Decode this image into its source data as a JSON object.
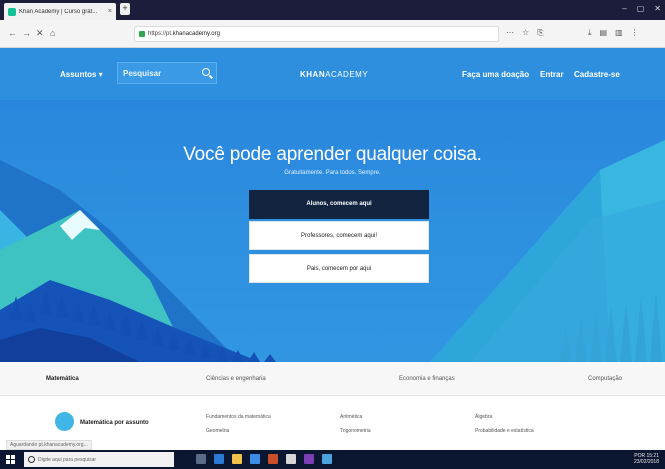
{
  "browser": {
    "tab_title": "Khan Academy | Curso grát...",
    "tab_close": "×",
    "new_tab": "+",
    "window_buttons": [
      "–",
      "▢",
      "✕"
    ],
    "nav_icons": [
      "←",
      "→",
      "✕",
      "⌂"
    ],
    "url_prefix": "https://pt.",
    "url_domain": "khanacademy.org",
    "url_actions": [
      "⋯",
      "☆",
      "⎘"
    ],
    "toolbar_icons": [
      "⤓",
      "▤",
      "▥",
      "⋮"
    ]
  },
  "header": {
    "browse": "Assuntos ▾",
    "search_placeholder": "Pesquisar",
    "logo_bold": "KHAN",
    "logo_rest": "ACADEMY",
    "donate": "Faça uma doação",
    "login": "Entrar",
    "signup": "Cadastre-se"
  },
  "hero": {
    "title": "Você pode aprender qualquer coisa.",
    "subtitle": "Gratuitamente. Para todos. Sempre.",
    "cta_learner": "Alunos, comecem aqui",
    "cta_teacher": "Professores, comecem aqui!",
    "cta_parent": "Pais, comecem por aqui"
  },
  "subjects": [
    "Matemática",
    "Ciências e engenharia",
    "Economia e finanças",
    "Computação"
  ],
  "content": {
    "course_title": "Matemática por assunto",
    "col1": [
      "Fundamentos da matemática",
      "Geometria"
    ],
    "col2": [
      "Aritmética",
      "Trigonometria"
    ],
    "col3": [
      "Álgebra",
      "Probabilidade e estatística"
    ]
  },
  "status_text": "Aguardando pt.khanacademy.org...",
  "taskbar": {
    "search_placeholder": "Digite aqui para pesquisar",
    "tray_time": "15:21",
    "tray_date": "23/02/2018",
    "tray_lang": "POR"
  },
  "colors": {
    "brand_blue": "#2d8fde",
    "dark_button": "#12243f",
    "taskbar": "#0b1630"
  }
}
